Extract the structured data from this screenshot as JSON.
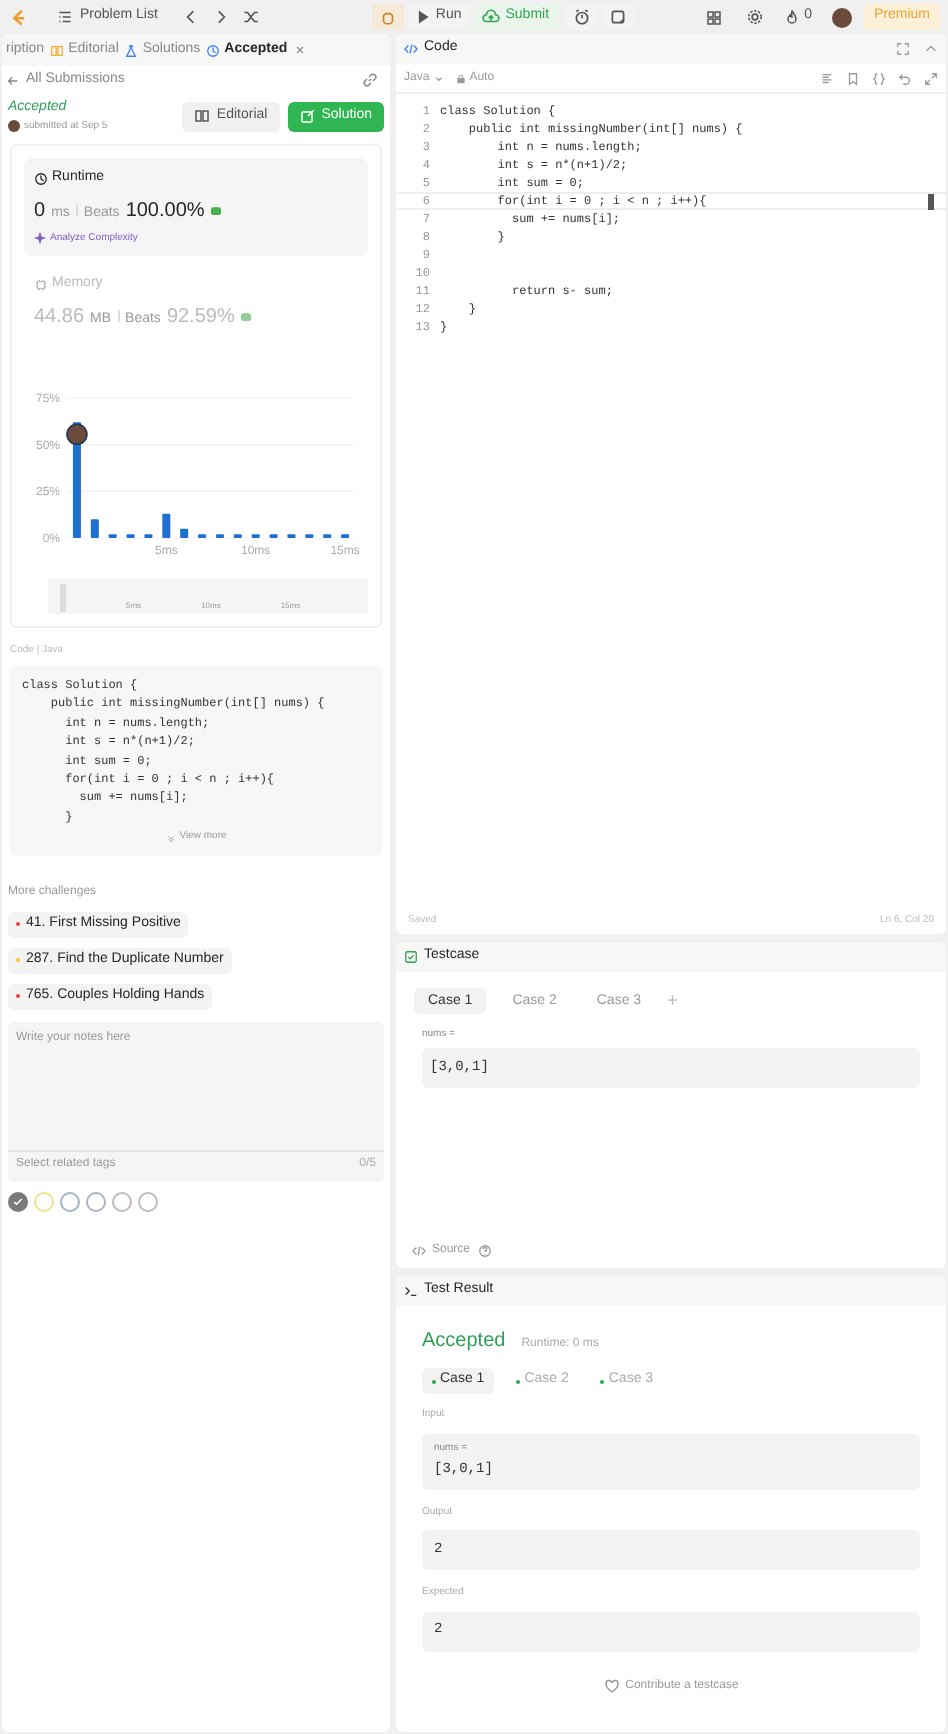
{
  "top_bar": {
    "problem_list": "Problem List",
    "run": "Run",
    "submit": "Submit",
    "streak": "0",
    "premium": "Premium"
  },
  "left_tabs": [
    {
      "label": "ription",
      "selected": false
    },
    {
      "label": "Editorial",
      "selected": false
    },
    {
      "label": "Solutions",
      "selected": false
    },
    {
      "label": "Accepted",
      "selected": true
    }
  ],
  "back_link": "All Submissions",
  "submission": {
    "status": "Accepted",
    "submitted": "submitted at Sep 5",
    "buttons": [
      "Editorial",
      "Solution"
    ]
  },
  "metrics": [
    {
      "label": "Runtime",
      "value": "0",
      "unit": "ms",
      "beats_label": "Beats",
      "beats": "100.00%",
      "selected": true,
      "link": "Analyze Complexity"
    },
    {
      "label": "Memory",
      "value": "44.86",
      "unit": "MB",
      "beats_label": "Beats",
      "beats": "92.59%",
      "selected": false
    }
  ],
  "chart_data": {
    "type": "bar",
    "x": [
      0,
      1,
      2,
      3,
      4,
      5,
      6,
      7,
      8,
      9,
      10,
      11,
      12,
      13,
      14,
      15
    ],
    "xlim": [
      -0.5,
      15.5
    ],
    "series": [
      {
        "color": "#1d6fd1",
        "values": [
          62,
          10,
          2,
          2,
          2,
          13,
          5,
          2,
          2,
          2,
          2,
          2,
          2,
          2,
          2,
          2
        ]
      }
    ],
    "ylim": [
      0,
      75
    ],
    "yticks": [
      {
        "value": 0,
        "label": "0%"
      },
      {
        "value": 25,
        "label": "25%"
      },
      {
        "value": 50,
        "label": "50%"
      },
      {
        "value": 75,
        "label": "75%"
      }
    ],
    "xticks": [
      {
        "value": 5,
        "label": "5ms"
      },
      {
        "value": 10,
        "label": "10ms"
      },
      {
        "value": 15,
        "label": "15ms"
      }
    ]
  },
  "navigator_labels": [
    "5ms",
    "10ms",
    "15ms"
  ],
  "code_preview": {
    "label": "Code | Java",
    "lines": [
      "class Solution {",
      "    public int missingNumber(int[] nums) {",
      "      int n = nums.length;",
      "      int s = n*(n+1)/2;",
      "      int sum = 0;",
      "      for(int i = 0 ; i < n ; i++){",
      "        sum += nums[i];",
      "      }"
    ],
    "view_more": "View more"
  },
  "more_challenges": {
    "title": "More challenges",
    "items": [
      {
        "label": "41. First Missing Positive",
        "color": "#ef4444"
      },
      {
        "label": "287. Find the Duplicate Number",
        "color": "#f5c542"
      },
      {
        "label": "765. Couples Holding Hands",
        "color": "#ef4444"
      }
    ]
  },
  "notes": {
    "placeholder": "Write your notes here",
    "tags_placeholder": "Select related tags",
    "count": "0/5"
  },
  "note_colors": [
    {
      "color": "#7a7a7a",
      "selected": true
    },
    {
      "color": "#f0e08c",
      "selected": false
    },
    {
      "color": "#9fb4c4",
      "selected": false
    },
    {
      "color": "#a9b3c2",
      "selected": false
    },
    {
      "color": "#c3b8be",
      "selected": false
    },
    {
      "color": "#bdbdbd",
      "selected": false
    }
  ],
  "editor": {
    "title": "Code",
    "language": "Java",
    "mode": "Auto",
    "lines": [
      {
        "number": "1",
        "text": "class Solution {",
        "current": false
      },
      {
        "number": "2",
        "text": "    public int missingNumber(int[] nums) {",
        "current": false
      },
      {
        "number": "3",
        "text": "        int n = nums.length;",
        "current": false
      },
      {
        "number": "4",
        "text": "        int s = n*(n+1)/2;",
        "current": false
      },
      {
        "number": "5",
        "text": "        int sum = 0;",
        "current": false
      },
      {
        "number": "6",
        "text": "        for(int i = 0 ; i < n ; i++){",
        "current": true
      },
      {
        "number": "7",
        "text": "          sum += nums[i];",
        "current": false
      },
      {
        "number": "8",
        "text": "        }",
        "current": false
      },
      {
        "number": "9",
        "current": false
      },
      {
        "number": "10",
        "current": false
      },
      {
        "number": "11",
        "text": "          return s- sum;",
        "current": false
      },
      {
        "number": "12",
        "text": "    }",
        "current": false
      },
      {
        "number": "13",
        "text": "}",
        "current": false
      }
    ],
    "saved": "Saved",
    "position": "Ln 6, Col 20"
  },
  "testcase": {
    "title": "Testcase",
    "cases": [
      {
        "label": "Case 1",
        "selected": true
      },
      {
        "label": "Case 2",
        "selected": false
      },
      {
        "label": "Case 3",
        "selected": false
      }
    ],
    "add": "+",
    "param": "nums =",
    "value": "[3,0,1]",
    "source": "Source"
  },
  "test_result": {
    "title": "Test Result",
    "status": "Accepted",
    "runtime": "Runtime: 0 ms",
    "cases": [
      {
        "label": "Case 1",
        "selected": true
      },
      {
        "label": "Case 2",
        "selected": false
      },
      {
        "label": "Case 3",
        "selected": false
      }
    ],
    "input_label": "Input",
    "param": "nums =",
    "input": "[3,0,1]",
    "output_label": "Output",
    "output": "2",
    "expected_label": "Expected",
    "expected": "2",
    "contribute": "Contribute a testcase"
  }
}
